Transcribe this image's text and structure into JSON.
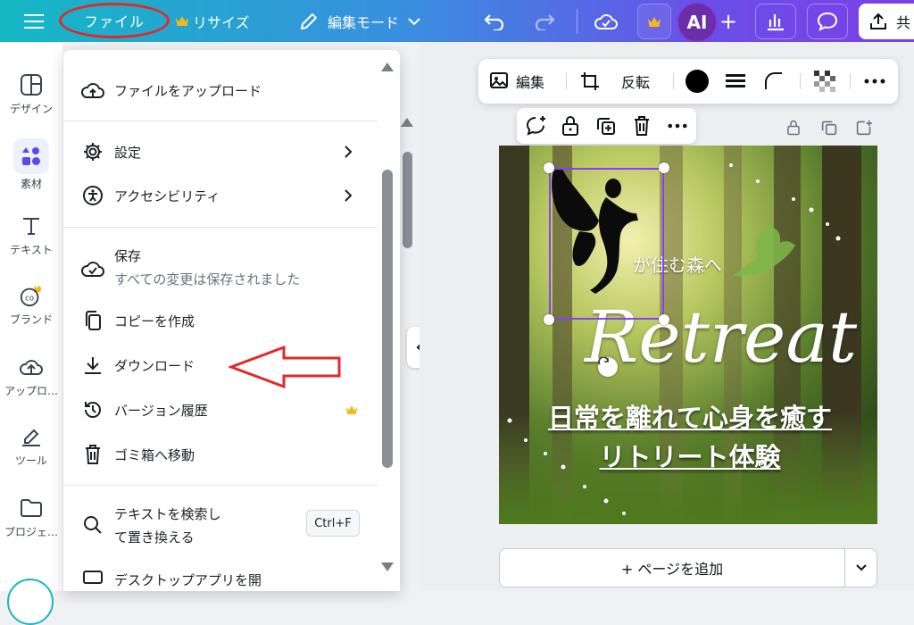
{
  "topbar": {
    "file_label": "ファイル",
    "resize_label": "リサイズ",
    "edit_mode_label": "編集モード",
    "avatar_initials": "AI",
    "add_symbol": "+",
    "share_label": "共",
    "colors": {
      "gradient_start": "#14b8c4",
      "gradient_end": "#7d3fe6",
      "highlight_ring": "#e22828"
    }
  },
  "sidebar": {
    "items": [
      {
        "label": "デザイン",
        "icon": "layout-icon"
      },
      {
        "label": "素材",
        "icon": "elements-icon"
      },
      {
        "label": "テキスト",
        "icon": "text-icon"
      },
      {
        "label": "ブランド",
        "icon": "brand-icon"
      },
      {
        "label": "アップロ…",
        "icon": "upload-cloud-icon"
      },
      {
        "label": "ツール",
        "icon": "draw-icon"
      },
      {
        "label": "プロジェ…",
        "icon": "folder-icon"
      }
    ]
  },
  "file_menu": {
    "upload": "ファイルをアップロード",
    "settings": "設定",
    "accessibility": "アクセシビリティ",
    "save": "保存",
    "save_status": "すべての変更は保存されました",
    "copy": "コピーを作成",
    "download": "ダウンロード",
    "version_history": "バージョン履歴",
    "trash": "ゴミ箱へ移動",
    "find_replace_1": "テキストを検索し",
    "find_replace_2": "て置き換える",
    "find_shortcut": "Ctrl+F",
    "desktop_app": "デスクトップアプリを開"
  },
  "context_toolbar": {
    "edit_label": "編集",
    "flip_label": "反転",
    "color_value": "#000000"
  },
  "canvas": {
    "subtitle": "が住む森へ",
    "title": "Retreat",
    "line1": "日常を離れて心身を癒す",
    "line2": "リトリート体験"
  },
  "footer": {
    "add_page_label": "+ ページを追加"
  }
}
